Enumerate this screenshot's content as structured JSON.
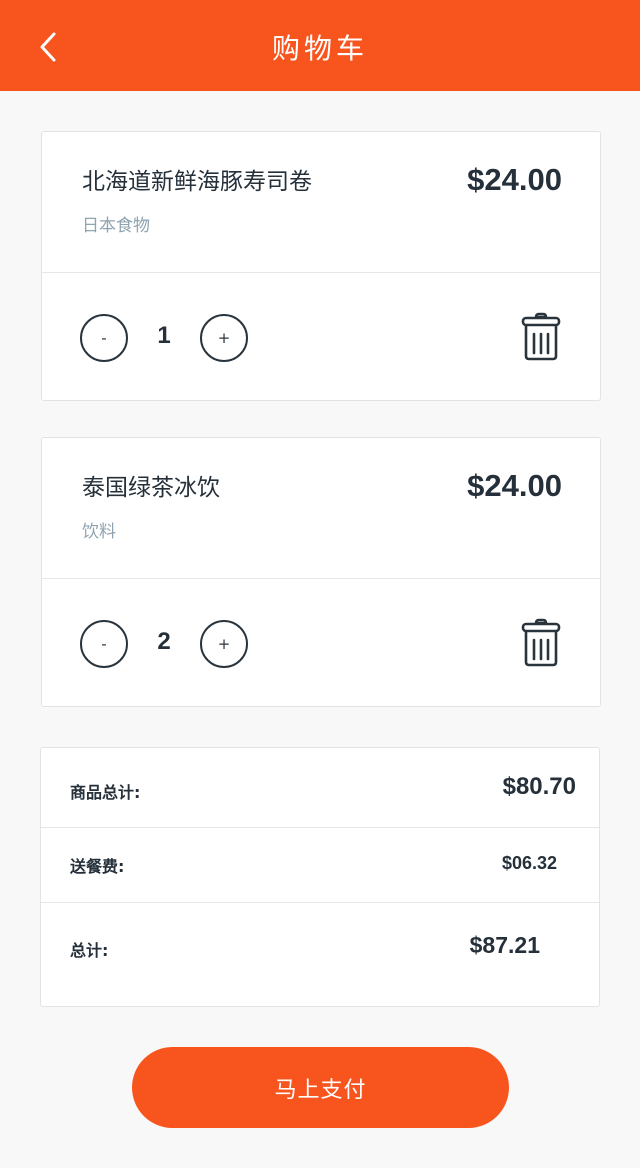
{
  "header": {
    "title": "购物车",
    "back_icon": "chevron-left-icon",
    "background": "#f8541e"
  },
  "cart": {
    "items": [
      {
        "name": "北海道新鲜海豚寿司卷",
        "category": "日本食物",
        "price": "$24.00",
        "quantity": "1",
        "minus_label": "-",
        "plus_label": "+"
      },
      {
        "name": "泰国绿茶冰饮",
        "category": "饮料",
        "price": "$24.00",
        "quantity": "2",
        "minus_label": "-",
        "plus_label": "+"
      }
    ]
  },
  "summary": {
    "subtotal_label": "商品总计:",
    "subtotal_value": "$80.70",
    "delivery_label": "送餐费:",
    "delivery_value": "$06.32",
    "total_label": "总计:",
    "total_value": "$87.21"
  },
  "pay_button": {
    "label": "马上支付"
  },
  "colors": {
    "accent": "#f8541e",
    "text_dark": "#25303a",
    "category_text": "#8fa3b0"
  }
}
